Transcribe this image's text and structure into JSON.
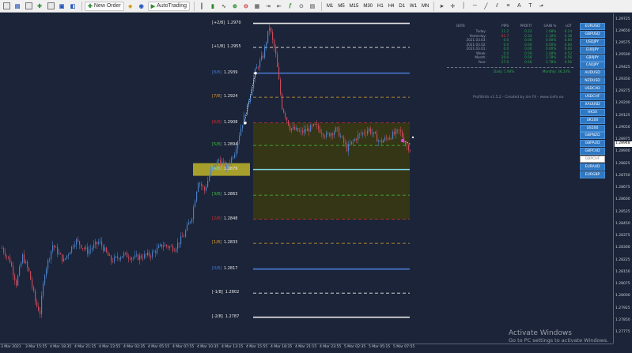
{
  "toolbar": {
    "new_order_label": "New Order",
    "autotrading_label": "AutoTrading",
    "timeframes": [
      "M1",
      "M5",
      "M15",
      "M30",
      "H1",
      "H4",
      "D1",
      "W1",
      "MN"
    ]
  },
  "murrey_levels": [
    {
      "level": "[+2/8]",
      "price": "1.2970",
      "color": "#e8e8e8"
    },
    {
      "level": "[+1/8]",
      "price": "1.2955",
      "color": "#e8e8e8"
    },
    {
      "level": "[8/8]",
      "price": "1.2939",
      "color": "#4a7bd8"
    },
    {
      "level": "[7/8]",
      "price": "1.2924",
      "color": "#e0a030"
    },
    {
      "level": "[6/8]",
      "price": "1.2908",
      "color": "#d83030"
    },
    {
      "level": "[5/8]",
      "price": "1.2894",
      "color": "#40c040"
    },
    {
      "level": "[4/8]",
      "price": "1.2879",
      "color": "#7fd8e8"
    },
    {
      "level": "[3/8]",
      "price": "1.2863",
      "color": "#40c040"
    },
    {
      "level": "[2/8]",
      "price": "1.2848",
      "color": "#d83030"
    },
    {
      "level": "[1/8]",
      "price": "1.2833",
      "color": "#e0a030"
    },
    {
      "level": "[0/8]",
      "price": "1.2817",
      "color": "#4a7bd8"
    },
    {
      "level": "[-1/8]",
      "price": "1.2802",
      "color": "#e8e8e8"
    },
    {
      "level": "[-2/8]",
      "price": "1.2787",
      "color": "#e8e8e8"
    }
  ],
  "stats": {
    "headers": [
      "DATE",
      "PIPS",
      "PROFIT",
      "GAIN %",
      "LOT"
    ],
    "rows": [
      {
        "date": "Today:",
        "pips": "11.2",
        "profit": "0.22",
        "gain": "1.08%",
        "lot": "0.14",
        "neg": false
      },
      {
        "date": "Yesterday:",
        "pips": "-41.7",
        "profit": "0.34",
        "gain": "1.10%",
        "lot": "0.38",
        "neg": true
      },
      {
        "date": "2021.03.03:",
        "pips": "0.0",
        "profit": "0.00",
        "gain": "0.00%",
        "lot": "0.00",
        "neg": false
      },
      {
        "date": "2021.03.02:",
        "pips": "0.0",
        "profit": "0.00",
        "gain": "0.00%",
        "lot": "0.00",
        "neg": false
      },
      {
        "date": "2021.03.01:",
        "pips": "0.0",
        "profit": "0.00",
        "gain": "0.00%",
        "lot": "0.00",
        "neg": false
      },
      {
        "date": "Week:",
        "pips": "0.0",
        "profit": "0.56",
        "gain": "1.48%",
        "lot": "0.52",
        "neg": false
      },
      {
        "date": "Month:",
        "pips": "20.0",
        "profit": "0.56",
        "gain": "2.78%",
        "lot": "0.56",
        "neg": false
      },
      {
        "date": "Year:",
        "pips": "27.0",
        "profit": "0.56",
        "gain": "2.78%",
        "lot": "0.56",
        "neg": false
      }
    ],
    "daily_label": "Daily: 1.94%",
    "monthly_label": "Monthly: 36.24%"
  },
  "credit": "ProfitInfo v1.5.2 - Created by Ice FX - www.icefx.eu",
  "symbols": [
    "EURUSD",
    "GBPUSD",
    "USDJPY",
    "EURJPY",
    "GBPJPY",
    "CADJPY",
    "AUDUSD",
    "NZDUSD",
    "USDCAD",
    "USDCHF",
    "XAUUSD",
    "HK50",
    "UK100",
    "US500",
    "GBPNZD",
    "GBPAUD",
    "GBPCAD",
    "GBPCHF",
    "EURAUD",
    "EURGBP"
  ],
  "active_symbol": "GBPCHF",
  "price_axis": {
    "ticks": [
      "1.29725",
      "1.29650",
      "1.29575",
      "1.29500",
      "1.29425",
      "1.29350",
      "1.29275",
      "1.29200",
      "1.29125",
      "1.29050",
      "1.28975",
      "1.28900",
      "1.28825",
      "1.28750",
      "1.28675",
      "1.28600",
      "1.28525",
      "1.28450",
      "1.28375",
      "1.28300",
      "1.28225",
      "1.28150",
      "1.28075",
      "1.28000",
      "1.27925",
      "1.27850",
      "1.27775"
    ],
    "current": "1.28948"
  },
  "time_axis": [
    "3 Mar 2021",
    "3 Mar 15:55",
    "4 Mar 18:35",
    "4 Mar 21:15",
    "4 Mar 23:55",
    "4 Mar 02:35",
    "4 Mar 05:15",
    "4 Mar 07:55",
    "4 Mar 10:35",
    "4 Mar 13:15",
    "4 Mar 15:55",
    "4 Mar 18:35",
    "4 Mar 21:15",
    "4 Mar 23:55",
    "5 Mar 02:35",
    "5 Mar 05:15",
    "5 Mar 07:55"
  ],
  "watermark": {
    "line1": "Activate Windows",
    "line2": "Go to PC settings to activate Windows."
  }
}
